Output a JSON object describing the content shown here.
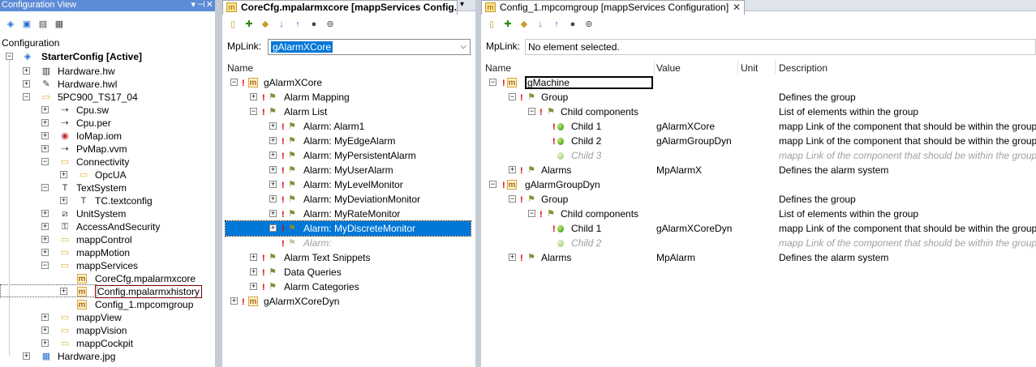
{
  "left": {
    "title": "Configuration View",
    "root_label": "Configuration",
    "config": "StarterConfig [Active]",
    "items": [
      {
        "label": "Hardware.hw",
        "icon": "hw-icon"
      },
      {
        "label": "Hardware.hwl",
        "icon": "hwl-icon"
      },
      {
        "label": "5PC900_TS17_04",
        "icon": "cpu-folder-icon"
      },
      {
        "label": "Cpu.sw",
        "icon": "sw-icon"
      },
      {
        "label": "Cpu.per",
        "icon": "per-icon"
      },
      {
        "label": "IoMap.iom",
        "icon": "iom-icon"
      },
      {
        "label": "PvMap.vvm",
        "icon": "vvm-icon"
      },
      {
        "label": "Connectivity",
        "icon": "folder-icon"
      },
      {
        "label": "OpcUA",
        "icon": "folder-icon"
      },
      {
        "label": "TextSystem",
        "icon": "text-icon"
      },
      {
        "label": "TC.textconfig",
        "icon": "textconfig-icon"
      },
      {
        "label": "UnitSystem",
        "icon": "unit-icon"
      },
      {
        "label": "AccessAndSecurity",
        "icon": "security-icon"
      },
      {
        "label": "mappControl",
        "icon": "folder-icon"
      },
      {
        "label": "mappMotion",
        "icon": "folder-icon"
      },
      {
        "label": "mappServices",
        "icon": "folder-icon"
      },
      {
        "label": "CoreCfg.mpalarmxcore",
        "icon": "mapp-file-icon"
      },
      {
        "label": "Config.mpalarmxhistory",
        "icon": "mapp-file-icon"
      },
      {
        "label": "Config_1.mpcomgroup",
        "icon": "mapp-file-icon"
      },
      {
        "label": "mappView",
        "icon": "folder-icon"
      },
      {
        "label": "mappVision",
        "icon": "folder-icon"
      },
      {
        "label": "mappCockpit",
        "icon": "folder-icon"
      },
      {
        "label": "Hardware.jpg",
        "icon": "image-icon"
      }
    ]
  },
  "middle": {
    "tab": "CoreCfg.mpalarmxcore [mappServices Config...",
    "mplink_label": "MpLink:",
    "mplink_value": "gAlarmXCore",
    "col_name": "Name",
    "rows": [
      {
        "label": "gAlarmXCore"
      },
      {
        "label": "Alarm Mapping"
      },
      {
        "label": "Alarm List"
      },
      {
        "label": "Alarm: Alarm1"
      },
      {
        "label": "Alarm: MyEdgeAlarm"
      },
      {
        "label": "Alarm: MyPersistentAlarm"
      },
      {
        "label": "Alarm: MyUserAlarm"
      },
      {
        "label": "Alarm: MyLevelMonitor"
      },
      {
        "label": "Alarm: MyDeviationMonitor"
      },
      {
        "label": "Alarm: MyRateMonitor"
      },
      {
        "label": "Alarm: MyDiscreteMonitor"
      },
      {
        "label": "Alarm:"
      },
      {
        "label": "Alarm Text Snippets"
      },
      {
        "label": "Data Queries"
      },
      {
        "label": "Alarm Categories"
      },
      {
        "label": "gAlarmXCoreDyn"
      }
    ]
  },
  "right": {
    "tab": "Config_1.mpcomgroup [mappServices Configuration]",
    "mplink_label": "MpLink:",
    "mplink_value": "No element selected.",
    "columns": [
      "Name",
      "Value",
      "Unit",
      "Description"
    ],
    "rows": [
      {
        "name": "gMachine",
        "value": "",
        "desc": ""
      },
      {
        "name": "Group",
        "value": "",
        "desc": "Defines the group"
      },
      {
        "name": "Child components",
        "value": "",
        "desc": "List of elements within the group"
      },
      {
        "name": "Child 1",
        "value": "gAlarmXCore",
        "desc": "mapp Link of the component that should be within the group"
      },
      {
        "name": "Child 2",
        "value": "gAlarmGroupDyn",
        "desc": "mapp Link of the component that should be within the group"
      },
      {
        "name": "Child 3",
        "value": "",
        "desc": "mapp Link of the component that should be within the group"
      },
      {
        "name": "Alarms",
        "value": "MpAlarmX",
        "desc": "Defines the alarm system"
      },
      {
        "name": "gAlarmGroupDyn",
        "value": "",
        "desc": ""
      },
      {
        "name": "Group",
        "value": "",
        "desc": "Defines the group"
      },
      {
        "name": "Child components",
        "value": "",
        "desc": "List of elements within the group"
      },
      {
        "name": "Child 1",
        "value": "gAlarmXCoreDyn",
        "desc": "mapp Link of the component that should be within the group"
      },
      {
        "name": "Child 2",
        "value": "",
        "desc": "mapp Link of the component that should be within the group"
      },
      {
        "name": "Alarms",
        "value": "MpAlarm",
        "desc": "Defines the alarm system"
      }
    ]
  }
}
